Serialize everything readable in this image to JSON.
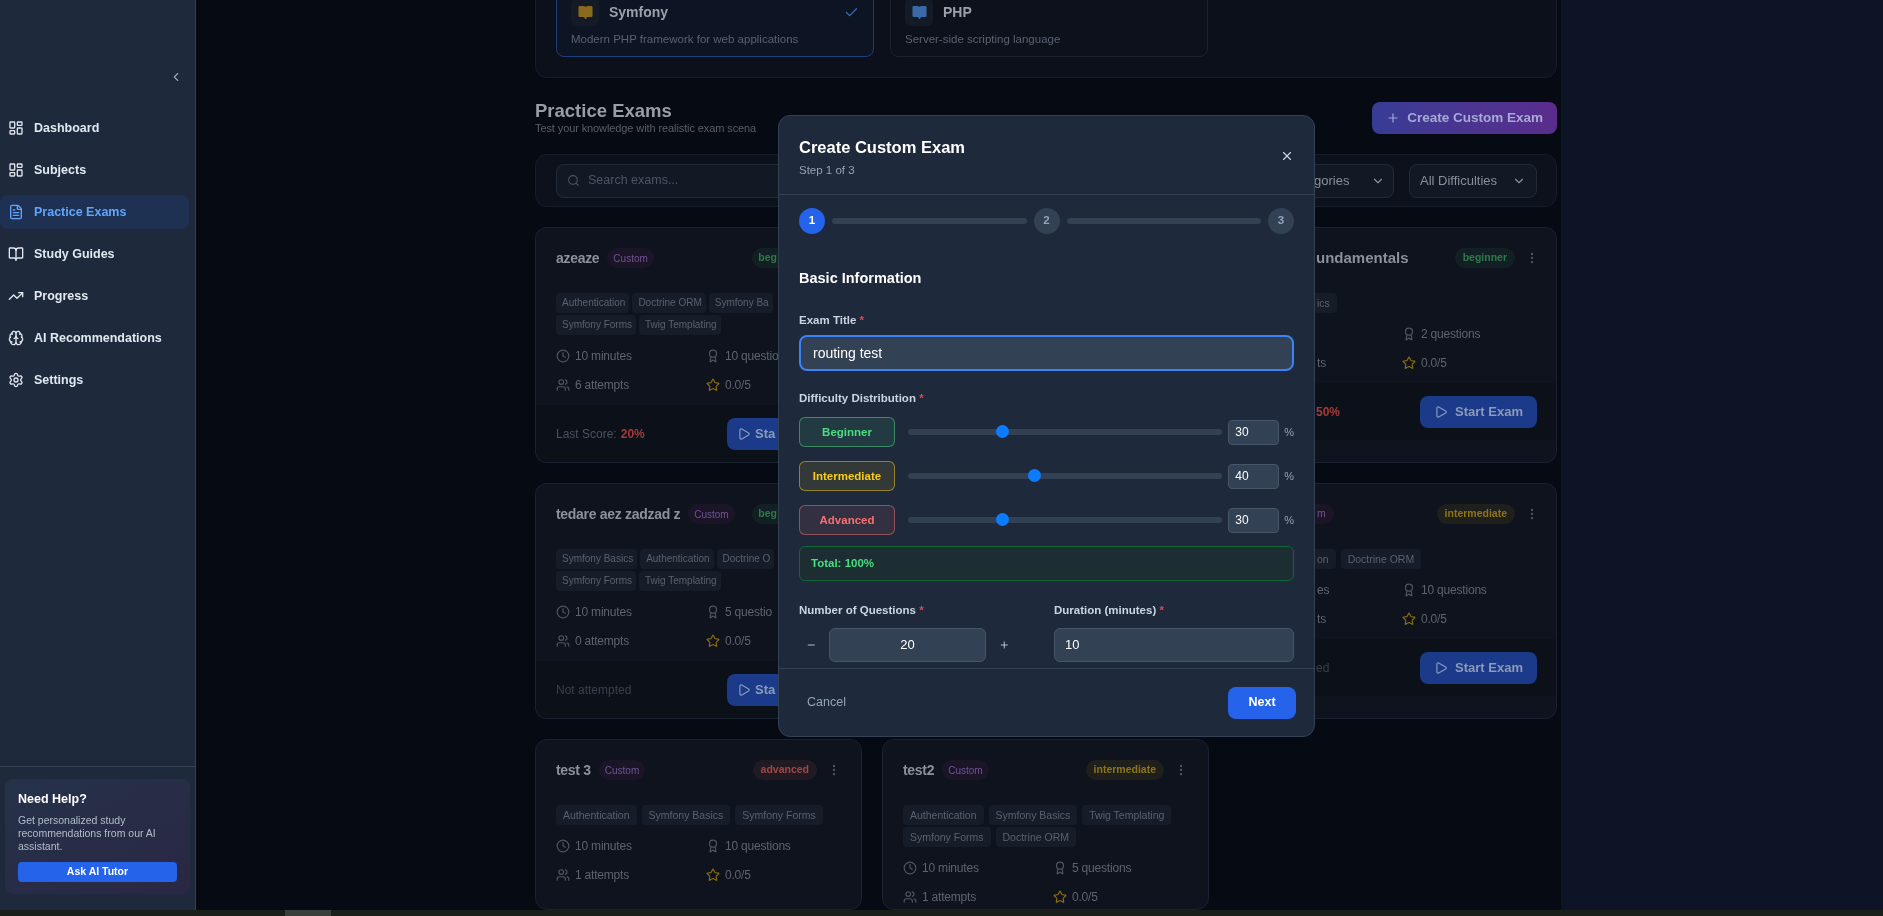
{
  "sidebar": {
    "items": [
      {
        "label": "Dashboard",
        "selected": false
      },
      {
        "label": "Subjects",
        "selected": false
      },
      {
        "label": "Practice Exams",
        "selected": true
      },
      {
        "label": "Study Guides",
        "selected": false
      },
      {
        "label": "Progress",
        "selected": false
      },
      {
        "label": "AI Recommendations",
        "selected": false
      },
      {
        "label": "Settings",
        "selected": false
      }
    ],
    "help": {
      "title": "Need Help?",
      "text": "Get personalized study recommendations from our AI assistant.",
      "button": "Ask AI Tutor"
    }
  },
  "subjects": [
    {
      "name": "Symfony",
      "description": "Modern PHP framework for web applications",
      "selected": true,
      "color": "#8a6a1c"
    },
    {
      "name": "PHP",
      "description": "Server-side scripting language",
      "selected": false,
      "color": "#3b6aa8"
    }
  ],
  "header": {
    "title": "Practice Exams",
    "subtitle": "Test your knowledge with realistic exam scena",
    "button": "Create Custom Exam"
  },
  "filters": {
    "search_placeholder": "Search exams...",
    "category": "gories",
    "difficulty": "All Difficulties"
  },
  "exam_rows": [
    {
      "cards": [
        {
          "kind": "left-cut",
          "title": "azeaze",
          "custom": "Custom",
          "difficulty": {
            "label": "beg",
            "color": "#2f7a4a"
          },
          "tags": [
            "Authentication",
            "Doctrine ORM",
            "Symfony Ba",
            "Symfony Forms",
            "Twig Templating"
          ],
          "duration": "10 minutes",
          "questions": "10 questio",
          "attempts": "6 attempts",
          "rating": "0.0/5",
          "footer": {
            "label": "Last Score:",
            "score": "20%"
          },
          "button": "Sta"
        },
        {
          "kind": "right-cut",
          "title": "undamentals",
          "difficulty": {
            "label": "beginner",
            "color": "#2f7a4a"
          },
          "tags": [
            "ics"
          ],
          "questions": "2 questions",
          "attempts": "ts",
          "rating": "0.0/5",
          "footer": {
            "score": "50%"
          },
          "button": "Start Exam"
        }
      ]
    },
    {
      "cards": [
        {
          "kind": "left-cut",
          "title": "tedare aez zadzad z",
          "custom": "Custom",
          "difficulty": {
            "label": "beg",
            "color": "#2f7a4a"
          },
          "tags": [
            "Symfony Basics",
            "Authentication",
            "Doctrine O",
            "Symfony Forms",
            "Twig Templating"
          ],
          "duration": "10 minutes",
          "questions": "5 questio",
          "attempts": "0 attempts",
          "rating": "0.0/5",
          "footer": {
            "label": "Not attempted"
          },
          "button": "Sta"
        },
        {
          "kind": "right-cut",
          "custom": "m",
          "difficulty": {
            "label": "intermediate",
            "color": "#8f7418"
          },
          "tags": [
            "on",
            "Doctrine ORM"
          ],
          "duration": "es",
          "questions": "10 questions",
          "attempts": "ts",
          "rating": "0.0/5",
          "footer": {
            "label": "ed"
          },
          "button": "Start Exam"
        }
      ]
    },
    {
      "cards": [
        {
          "kind": "full",
          "title": "test 3",
          "custom": "Custom",
          "difficulty": {
            "label": "advanced",
            "color": "#a04848"
          },
          "tags": [
            "Authentication",
            "Symfony Basics",
            "Symfony Forms"
          ],
          "duration": "10 minutes",
          "questions": "10 questions",
          "attempts": "1 attempts",
          "rating": "0.0/5"
        },
        {
          "kind": "full",
          "title": "test2",
          "custom": "Custom",
          "difficulty": {
            "label": "intermediate",
            "color": "#8f7418"
          },
          "tags": [
            "Authentication",
            "Symfony Basics",
            "Twig Templating",
            "Symfony Forms",
            "Doctrine ORM"
          ],
          "duration": "10 minutes",
          "questions": "5 questions",
          "attempts": "1 attempts",
          "rating": "0.0/5"
        }
      ]
    }
  ],
  "modal": {
    "title": "Create Custom Exam",
    "step": "Step 1 of 3",
    "steps": [
      {
        "label": "1",
        "selected": true
      },
      {
        "label": "2",
        "selected": false
      },
      {
        "label": "3",
        "selected": false
      }
    ],
    "section": "Basic Information",
    "exam_title": {
      "label": "Exam Title",
      "mark": "*",
      "value": "routing test"
    },
    "distribution": {
      "label": "Difficulty Distribution",
      "mark": "*",
      "rows": [
        {
          "label": "Beginner",
          "color": "#4ade80",
          "level": 0.3,
          "value": "30",
          "unit": "%"
        },
        {
          "label": "Intermediate",
          "color": "#facc15",
          "level": 0.4,
          "value": "40",
          "unit": "%"
        },
        {
          "label": "Advanced",
          "color": "#f87171",
          "level": 0.3,
          "value": "30",
          "unit": "%"
        }
      ]
    },
    "total": "Total: 100%",
    "questions": {
      "label": "Number of Questions",
      "mark": "*",
      "value": "20"
    },
    "duration": {
      "label": "Duration (minutes)",
      "mark": "*",
      "value": "10"
    },
    "cancel": "Cancel",
    "next": "Next"
  }
}
